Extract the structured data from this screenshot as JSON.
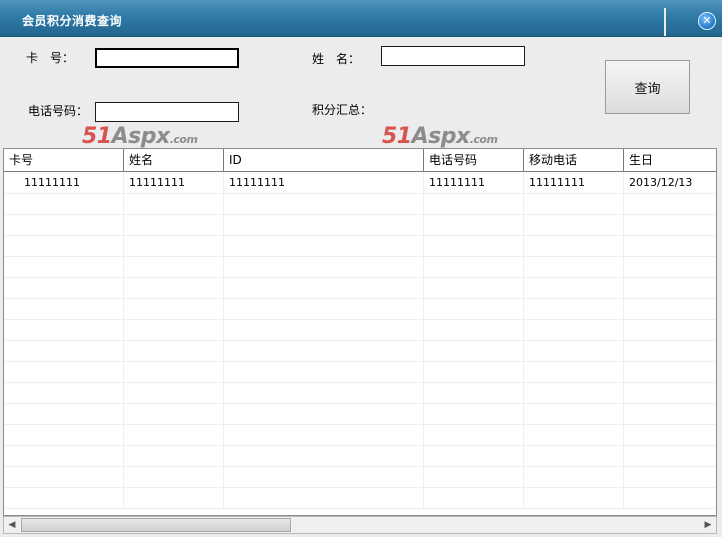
{
  "window": {
    "title": "会员积分消费查询",
    "close_glyph": "✕"
  },
  "form": {
    "card_label": "卡　号：",
    "card_value": "",
    "name_label": "姓　名：",
    "name_value": "",
    "phone_label": "电话号码：",
    "phone_value": "",
    "points_label": "积分汇总：",
    "query_button": "查询"
  },
  "watermark": {
    "num": "51",
    "text": "Aspx",
    "domain": ".com"
  },
  "table": {
    "columns": [
      "卡号",
      "姓名",
      "ID",
      "电话号码",
      "移动电话",
      "生日"
    ],
    "rows": [
      [
        "11111111",
        "11111111",
        "11111111",
        "11111111",
        "11111111",
        "2013/12/13"
      ]
    ]
  },
  "scrollbar": {
    "left_arrow": "◀",
    "right_arrow": "▶"
  },
  "icons": {
    "close": "close-icon",
    "scroll_left": "arrow-left-icon",
    "scroll_right": "arrow-right-icon"
  }
}
